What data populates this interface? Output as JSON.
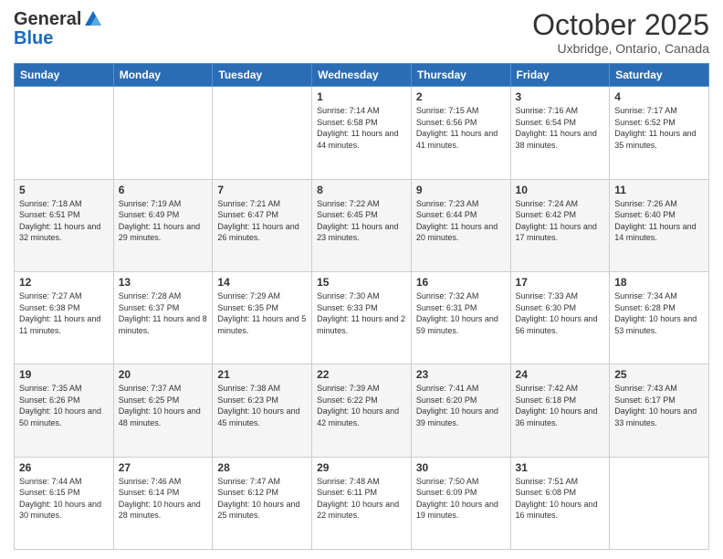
{
  "header": {
    "logo_general": "General",
    "logo_blue": "Blue",
    "title": "October 2025",
    "subtitle": "Uxbridge, Ontario, Canada"
  },
  "days_of_week": [
    "Sunday",
    "Monday",
    "Tuesday",
    "Wednesday",
    "Thursday",
    "Friday",
    "Saturday"
  ],
  "weeks": [
    [
      {
        "day": "",
        "info": ""
      },
      {
        "day": "",
        "info": ""
      },
      {
        "day": "",
        "info": ""
      },
      {
        "day": "1",
        "info": "Sunrise: 7:14 AM\nSunset: 6:58 PM\nDaylight: 11 hours and 44 minutes."
      },
      {
        "day": "2",
        "info": "Sunrise: 7:15 AM\nSunset: 6:56 PM\nDaylight: 11 hours and 41 minutes."
      },
      {
        "day": "3",
        "info": "Sunrise: 7:16 AM\nSunset: 6:54 PM\nDaylight: 11 hours and 38 minutes."
      },
      {
        "day": "4",
        "info": "Sunrise: 7:17 AM\nSunset: 6:52 PM\nDaylight: 11 hours and 35 minutes."
      }
    ],
    [
      {
        "day": "5",
        "info": "Sunrise: 7:18 AM\nSunset: 6:51 PM\nDaylight: 11 hours and 32 minutes."
      },
      {
        "day": "6",
        "info": "Sunrise: 7:19 AM\nSunset: 6:49 PM\nDaylight: 11 hours and 29 minutes."
      },
      {
        "day": "7",
        "info": "Sunrise: 7:21 AM\nSunset: 6:47 PM\nDaylight: 11 hours and 26 minutes."
      },
      {
        "day": "8",
        "info": "Sunrise: 7:22 AM\nSunset: 6:45 PM\nDaylight: 11 hours and 23 minutes."
      },
      {
        "day": "9",
        "info": "Sunrise: 7:23 AM\nSunset: 6:44 PM\nDaylight: 11 hours and 20 minutes."
      },
      {
        "day": "10",
        "info": "Sunrise: 7:24 AM\nSunset: 6:42 PM\nDaylight: 11 hours and 17 minutes."
      },
      {
        "day": "11",
        "info": "Sunrise: 7:26 AM\nSunset: 6:40 PM\nDaylight: 11 hours and 14 minutes."
      }
    ],
    [
      {
        "day": "12",
        "info": "Sunrise: 7:27 AM\nSunset: 6:38 PM\nDaylight: 11 hours and 11 minutes."
      },
      {
        "day": "13",
        "info": "Sunrise: 7:28 AM\nSunset: 6:37 PM\nDaylight: 11 hours and 8 minutes."
      },
      {
        "day": "14",
        "info": "Sunrise: 7:29 AM\nSunset: 6:35 PM\nDaylight: 11 hours and 5 minutes."
      },
      {
        "day": "15",
        "info": "Sunrise: 7:30 AM\nSunset: 6:33 PM\nDaylight: 11 hours and 2 minutes."
      },
      {
        "day": "16",
        "info": "Sunrise: 7:32 AM\nSunset: 6:31 PM\nDaylight: 10 hours and 59 minutes."
      },
      {
        "day": "17",
        "info": "Sunrise: 7:33 AM\nSunset: 6:30 PM\nDaylight: 10 hours and 56 minutes."
      },
      {
        "day": "18",
        "info": "Sunrise: 7:34 AM\nSunset: 6:28 PM\nDaylight: 10 hours and 53 minutes."
      }
    ],
    [
      {
        "day": "19",
        "info": "Sunrise: 7:35 AM\nSunset: 6:26 PM\nDaylight: 10 hours and 50 minutes."
      },
      {
        "day": "20",
        "info": "Sunrise: 7:37 AM\nSunset: 6:25 PM\nDaylight: 10 hours and 48 minutes."
      },
      {
        "day": "21",
        "info": "Sunrise: 7:38 AM\nSunset: 6:23 PM\nDaylight: 10 hours and 45 minutes."
      },
      {
        "day": "22",
        "info": "Sunrise: 7:39 AM\nSunset: 6:22 PM\nDaylight: 10 hours and 42 minutes."
      },
      {
        "day": "23",
        "info": "Sunrise: 7:41 AM\nSunset: 6:20 PM\nDaylight: 10 hours and 39 minutes."
      },
      {
        "day": "24",
        "info": "Sunrise: 7:42 AM\nSunset: 6:18 PM\nDaylight: 10 hours and 36 minutes."
      },
      {
        "day": "25",
        "info": "Sunrise: 7:43 AM\nSunset: 6:17 PM\nDaylight: 10 hours and 33 minutes."
      }
    ],
    [
      {
        "day": "26",
        "info": "Sunrise: 7:44 AM\nSunset: 6:15 PM\nDaylight: 10 hours and 30 minutes."
      },
      {
        "day": "27",
        "info": "Sunrise: 7:46 AM\nSunset: 6:14 PM\nDaylight: 10 hours and 28 minutes."
      },
      {
        "day": "28",
        "info": "Sunrise: 7:47 AM\nSunset: 6:12 PM\nDaylight: 10 hours and 25 minutes."
      },
      {
        "day": "29",
        "info": "Sunrise: 7:48 AM\nSunset: 6:11 PM\nDaylight: 10 hours and 22 minutes."
      },
      {
        "day": "30",
        "info": "Sunrise: 7:50 AM\nSunset: 6:09 PM\nDaylight: 10 hours and 19 minutes."
      },
      {
        "day": "31",
        "info": "Sunrise: 7:51 AM\nSunset: 6:08 PM\nDaylight: 10 hours and 16 minutes."
      },
      {
        "day": "",
        "info": ""
      }
    ]
  ]
}
